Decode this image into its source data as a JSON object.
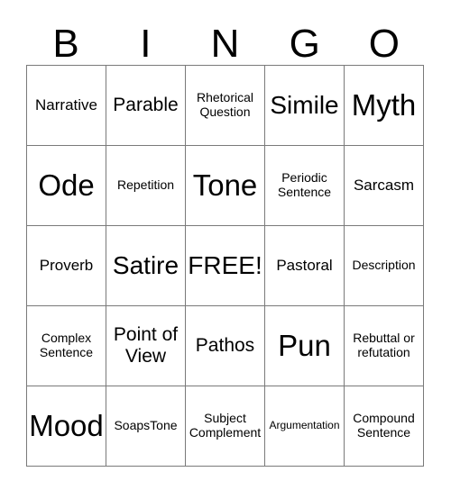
{
  "card": {
    "header_letters": [
      "B",
      "I",
      "N",
      "G",
      "O"
    ],
    "rows": [
      [
        {
          "label": "Narrative",
          "size": "sm"
        },
        {
          "label": "Parable",
          "size": "md"
        },
        {
          "label": "Rhetorical Question",
          "size": "xs"
        },
        {
          "label": "Simile",
          "size": "lg"
        },
        {
          "label": "Myth",
          "size": "xl"
        }
      ],
      [
        {
          "label": "Ode",
          "size": "xl"
        },
        {
          "label": "Repetition",
          "size": "xs"
        },
        {
          "label": "Tone",
          "size": "xl"
        },
        {
          "label": "Periodic Sentence",
          "size": "xs"
        },
        {
          "label": "Sarcasm",
          "size": "sm"
        }
      ],
      [
        {
          "label": "Proverb",
          "size": "sm"
        },
        {
          "label": "Satire",
          "size": "lg"
        },
        {
          "label": "FREE!",
          "size": "lg"
        },
        {
          "label": "Pastoral",
          "size": "sm"
        },
        {
          "label": "Description",
          "size": "xs"
        }
      ],
      [
        {
          "label": "Complex Sentence",
          "size": "xs"
        },
        {
          "label": "Point of View",
          "size": "md"
        },
        {
          "label": "Pathos",
          "size": "md"
        },
        {
          "label": "Pun",
          "size": "xl"
        },
        {
          "label": "Rebuttal or refutation",
          "size": "xs"
        }
      ],
      [
        {
          "label": "Mood",
          "size": "xl"
        },
        {
          "label": "SoapsTone",
          "size": "xs"
        },
        {
          "label": "Subject Complement",
          "size": "xs"
        },
        {
          "label": "Argumentation",
          "size": "xxs"
        },
        {
          "label": "Compound Sentence",
          "size": "xs"
        }
      ]
    ],
    "free_space": {
      "row": 2,
      "column": 2,
      "label": "FREE!"
    },
    "colors": {
      "background": "#ffffff",
      "text": "#000000",
      "grid_line": "#7a7a7a"
    }
  }
}
